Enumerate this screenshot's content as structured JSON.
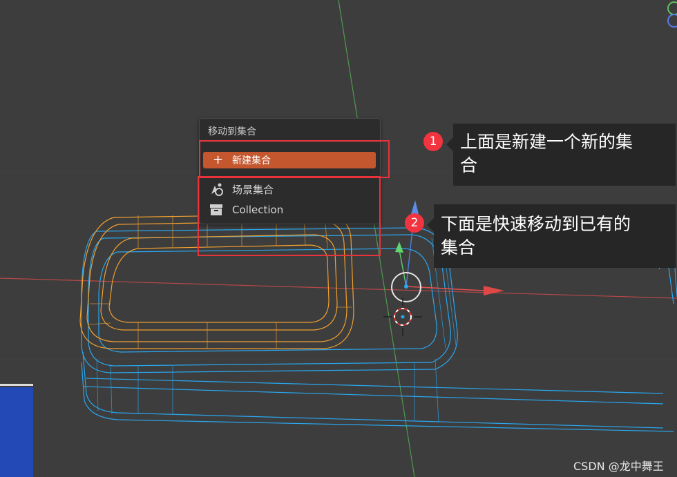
{
  "menu": {
    "title": "移动到集合",
    "new_collection": "新建集合",
    "items": [
      {
        "label": "场景集合",
        "icon": "scene-collection-icon"
      },
      {
        "label": "Collection",
        "icon": "collection-box-icon"
      }
    ]
  },
  "annotations": [
    {
      "number": "1",
      "text_line1": "上面是新建一个新的集",
      "text_line2": "合"
    },
    {
      "number": "2",
      "text_line1": "下面是快速移动到已有的",
      "text_line2": "集合"
    }
  ],
  "watermark": "CSDN @龙中舞王",
  "colors": {
    "viewport_bg": "#3d3d3d",
    "menu_bg": "#2c2c2c",
    "highlight": "#c4572e",
    "annotation_red": "#e8333a",
    "selected_wire": "#f0a030",
    "wire_blue": "#29a7f0",
    "x_axis": "#c84a4a",
    "y_axis": "#4a9a4a"
  }
}
